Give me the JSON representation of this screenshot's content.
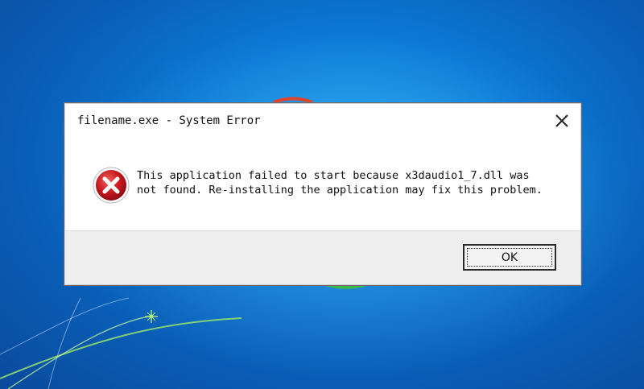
{
  "dialog": {
    "title": "filename.exe - System Error",
    "message_line1": "This application failed to start because x3daudio1_7.dll was",
    "message_line2": "not found. Re-installing the application may fix this problem.",
    "ok_label": "OK",
    "icon": "error-icon",
    "close_icon": "close-icon"
  },
  "colors": {
    "desktop_blue": "#0a7ad6",
    "error_red": "#c8171e",
    "footer_gray": "#efefef"
  }
}
